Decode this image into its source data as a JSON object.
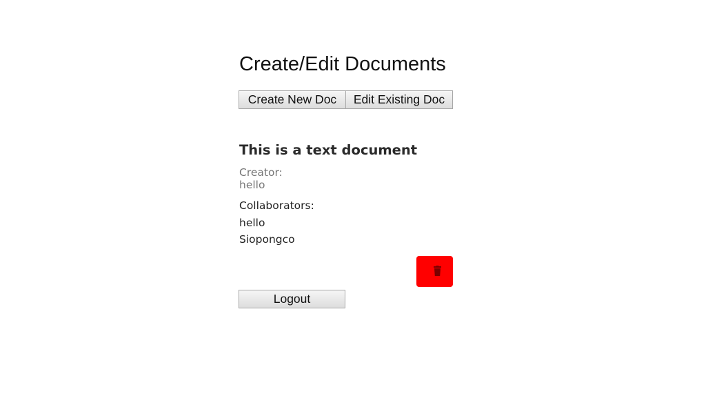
{
  "page": {
    "title": "Create/Edit Documents"
  },
  "toolbar": {
    "create_label": "Create New Doc",
    "edit_label": "Edit Existing Doc"
  },
  "document": {
    "title": "This is a text document",
    "creator_label": "Creator:",
    "creator": "hello",
    "collaborators_label": "Collaborators:",
    "collaborators": [
      "hello",
      "Siopongco"
    ],
    "delete_icon": "trash-icon",
    "delete_color": "#ff0000"
  },
  "footer": {
    "logout_label": "Logout"
  }
}
